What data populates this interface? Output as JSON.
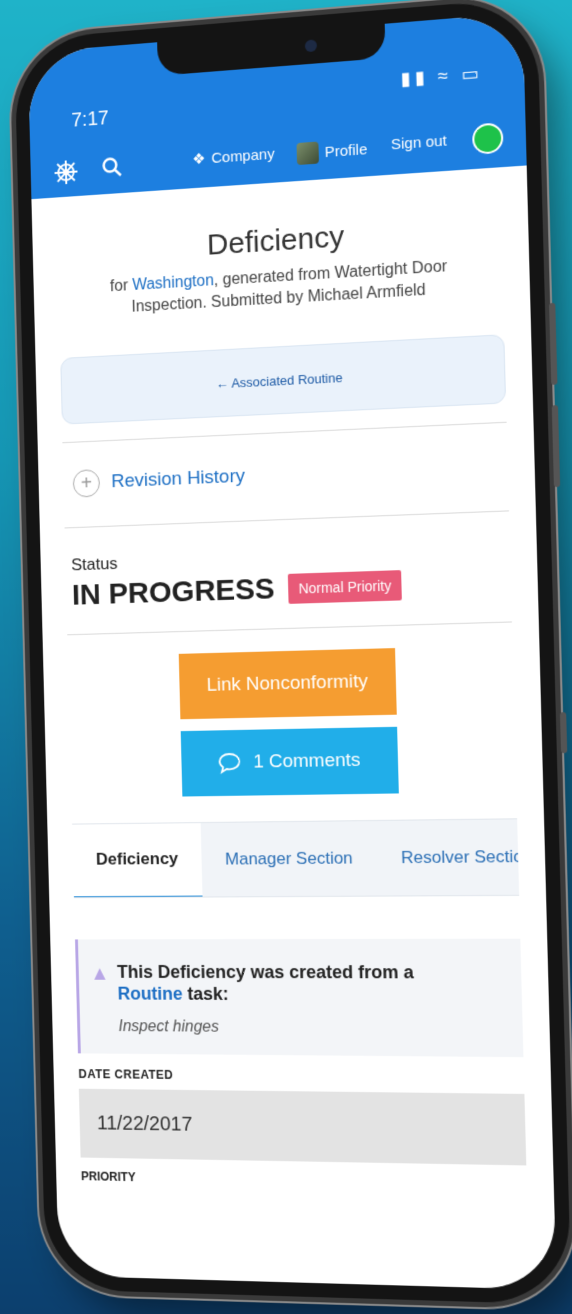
{
  "status_bar": {
    "time": "7:17",
    "icons": "signal wifi battery"
  },
  "nav": {
    "logo_icon": "ship-wheel-icon",
    "search_icon": "search-icon",
    "company_label": "Company",
    "profile_label": "Profile",
    "signout_label": "Sign out",
    "online_color": "#1ec24a"
  },
  "page": {
    "title": "Deficiency",
    "subtitle_prefix": "for ",
    "subtitle_link": "Washington",
    "subtitle_rest": ", generated from Watertight Door Inspection. Submitted by Michael Armfield",
    "associated_label": "← Associated Routine",
    "revision_label": "Revision History"
  },
  "status": {
    "label": "Status",
    "value": "IN PROGRESS",
    "priority": "Normal Priority"
  },
  "actions": {
    "link_nonconformity": "Link Nonconformity",
    "comments": "1 Comments"
  },
  "tabs": [
    "Deficiency",
    "Manager Section",
    "Resolver Sectic"
  ],
  "alert": {
    "line1": "This Deficiency was created from a",
    "link": "Routine",
    "line2": " task:",
    "task": "Inspect hinges"
  },
  "fields": {
    "date_created_label": "DATE CREATED",
    "date_created_value": "11/22/2017",
    "priority_label": "PRIORITY"
  }
}
